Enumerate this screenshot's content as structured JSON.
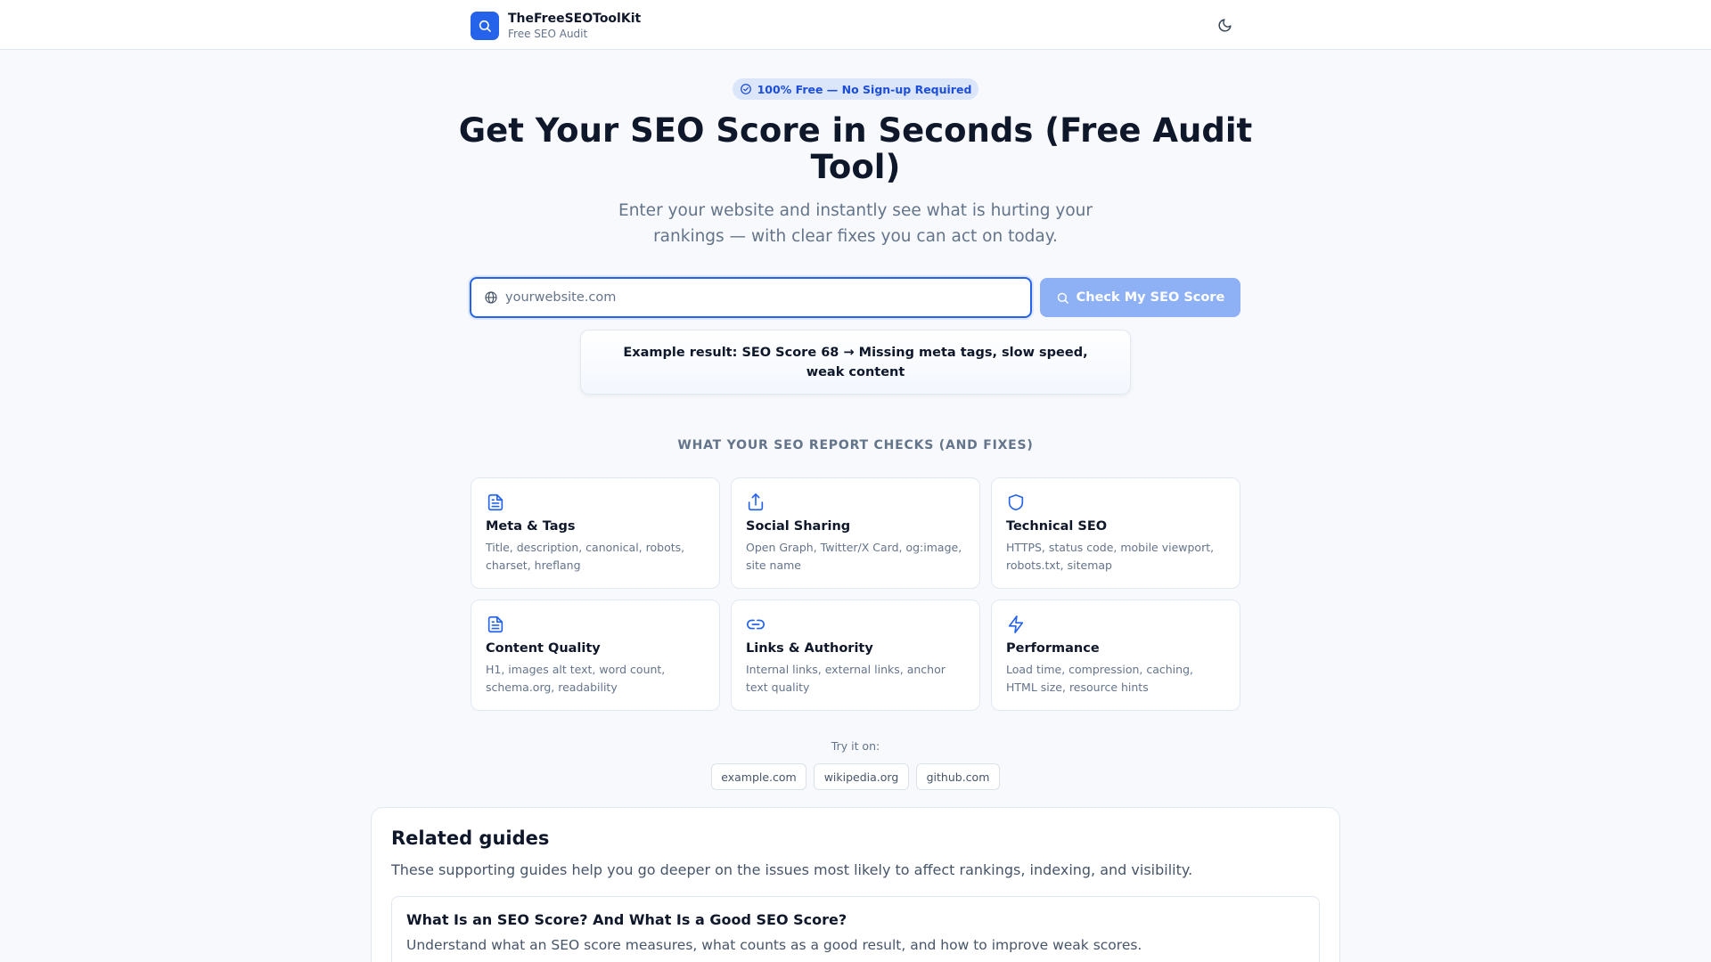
{
  "header": {
    "brand_name": "TheFreeSEOToolKit",
    "brand_sub": "Free SEO Audit",
    "logo_icon": "search-icon",
    "theme_icon": "moon-icon"
  },
  "hero": {
    "badge": "100% Free — No Sign-up Required",
    "title": "Get Your SEO Score in Seconds (Free Audit Tool)",
    "subtitle": "Enter your website and instantly see what is hurting your rankings — with clear fixes you can act on today."
  },
  "search": {
    "placeholder": "yourwebsite.com",
    "value": "",
    "button_label": "Check My SEO Score"
  },
  "example": "Example result: SEO Score 68 → Missing meta tags, slow speed, weak content",
  "features": {
    "heading": "WHAT YOUR SEO REPORT CHECKS (AND FIXES)",
    "items": [
      {
        "title": "Meta & Tags",
        "desc": "Title, description, canonical, robots, charset, hreflang",
        "icon": "document-icon"
      },
      {
        "title": "Social Sharing",
        "desc": "Open Graph, Twitter/X Card, og:image, site name",
        "icon": "share-icon"
      },
      {
        "title": "Technical SEO",
        "desc": "HTTPS, status code, mobile viewport, robots.txt, sitemap",
        "icon": "shield-icon"
      },
      {
        "title": "Content Quality",
        "desc": "H1, images alt text, word count, schema.org, readability",
        "icon": "document-icon"
      },
      {
        "title": "Links & Authority",
        "desc": "Internal links, external links, anchor text quality",
        "icon": "link-icon"
      },
      {
        "title": "Performance",
        "desc": "Load time, compression, caching, HTML size, resource hints",
        "icon": "lightning-icon"
      }
    ]
  },
  "try": {
    "label": "Try it on:",
    "examples": [
      "example.com",
      "wikipedia.org",
      "github.com"
    ]
  },
  "related": {
    "title": "Related guides",
    "desc": "These supporting guides help you go deeper on the issues most likely to affect rankings, indexing, and visibility.",
    "guides": [
      {
        "title": "What Is an SEO Score? And What Is a Good SEO Score?",
        "desc": "Understand what an SEO score measures, what counts as a good result, and how to improve weak scores."
      }
    ]
  },
  "colors": {
    "accent": "#2563eb",
    "button_disabled": "#8eb0f5",
    "badge_bg": "#dbe6fb",
    "text_muted": "#64748b"
  }
}
